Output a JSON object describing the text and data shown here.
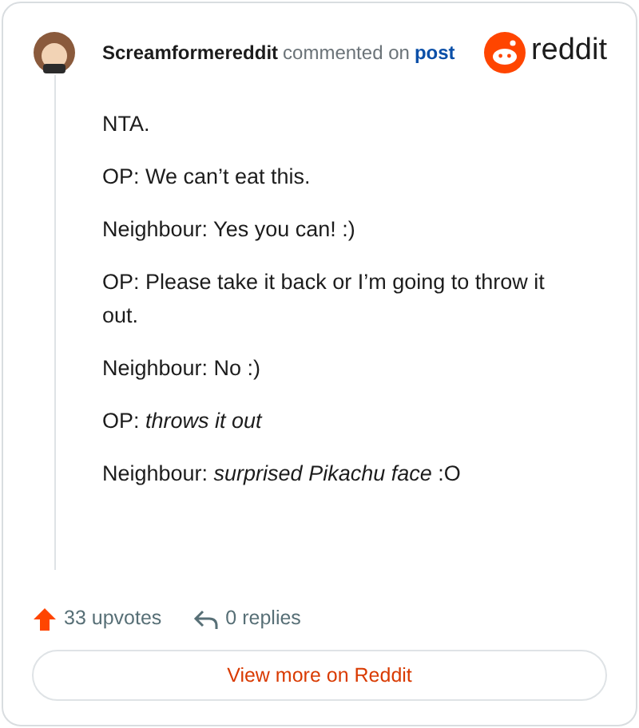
{
  "header": {
    "author": "Screamformereddit",
    "action": "commented on",
    "link": "post",
    "logo_text": "reddit"
  },
  "comment": {
    "paragraphs": [
      "NTA.",
      "OP: We can’t eat this.",
      "Neighbour: Yes you can! :)",
      "OP: Please take it back or I’m going to throw it out.",
      "Neighbour: No :)",
      "OP: *throws it out*",
      "Neighbour: *surprised Pikachu face* :O"
    ]
  },
  "footer": {
    "upvotes": "33 upvotes",
    "replies": "0 replies",
    "button": "View more on Reddit"
  }
}
